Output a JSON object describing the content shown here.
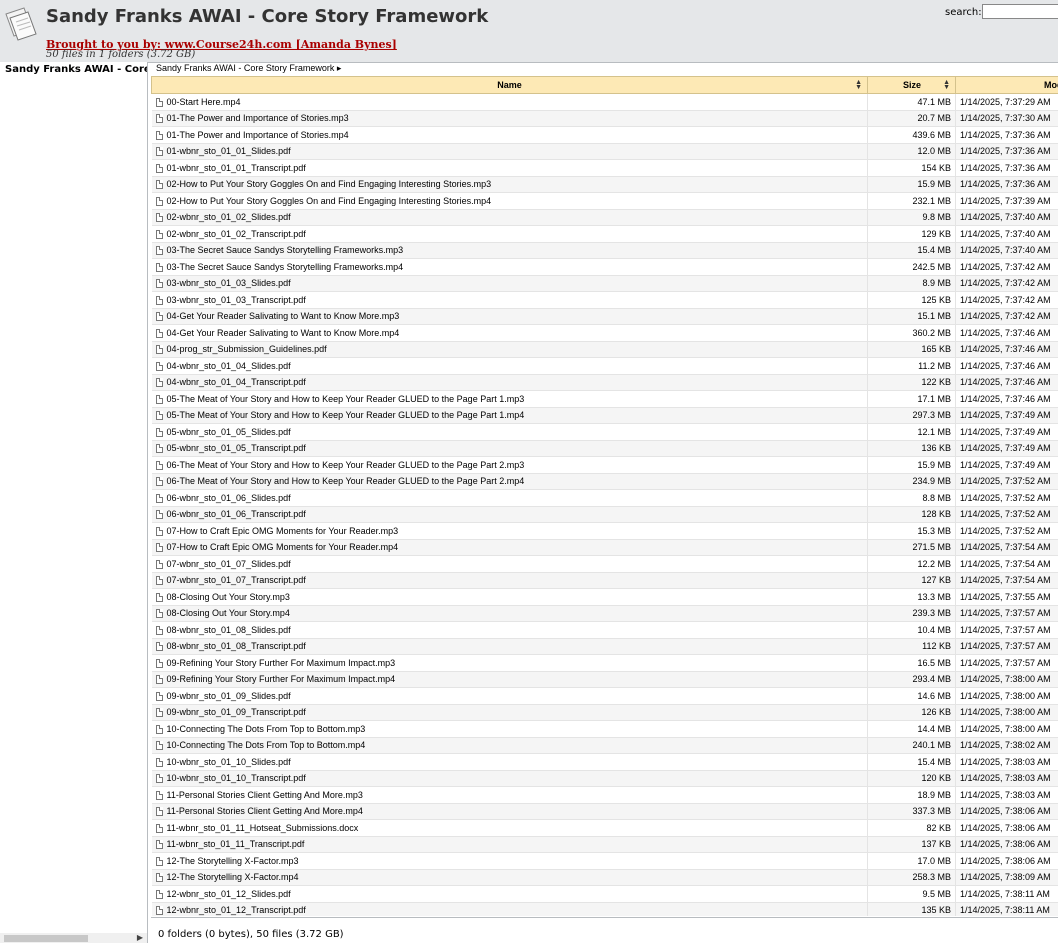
{
  "header": {
    "title": "Sandy Franks AWAI - Core Story Framework",
    "brought_by": "Brought to you by: www.Course24h.com [Amanda Bynes]",
    "summary": "50 files in 1 folders (3.72 GB)",
    "search_label": "search:",
    "search_value": ""
  },
  "tree": {
    "root_label": "Sandy Franks AWAI - Core Story Framework"
  },
  "breadcrumb": {
    "label": "Sandy Franks AWAI - Core Story Framework ▸"
  },
  "table": {
    "columns": {
      "name": "Name",
      "size": "Size",
      "modified": "Modified"
    },
    "rows": [
      {
        "name": "00-Start Here.mp4",
        "size": "47.1 MB",
        "modified": "1/14/2025, 7:37:29 AM"
      },
      {
        "name": "01-The Power and Importance of Stories.mp3",
        "size": "20.7 MB",
        "modified": "1/14/2025, 7:37:30 AM"
      },
      {
        "name": "01-The Power and Importance of Stories.mp4",
        "size": "439.6 MB",
        "modified": "1/14/2025, 7:37:36 AM"
      },
      {
        "name": "01-wbnr_sto_01_01_Slides.pdf",
        "size": "12.0 MB",
        "modified": "1/14/2025, 7:37:36 AM"
      },
      {
        "name": "01-wbnr_sto_01_01_Transcript.pdf",
        "size": "154 KB",
        "modified": "1/14/2025, 7:37:36 AM"
      },
      {
        "name": "02-How to Put Your Story Goggles On and Find Engaging Interesting Stories.mp3",
        "size": "15.9 MB",
        "modified": "1/14/2025, 7:37:36 AM"
      },
      {
        "name": "02-How to Put Your Story Goggles On and Find Engaging Interesting Stories.mp4",
        "size": "232.1 MB",
        "modified": "1/14/2025, 7:37:39 AM"
      },
      {
        "name": "02-wbnr_sto_01_02_Slides.pdf",
        "size": "9.8 MB",
        "modified": "1/14/2025, 7:37:40 AM"
      },
      {
        "name": "02-wbnr_sto_01_02_Transcript.pdf",
        "size": "129 KB",
        "modified": "1/14/2025, 7:37:40 AM"
      },
      {
        "name": "03-The Secret Sauce Sandys Storytelling Frameworks.mp3",
        "size": "15.4 MB",
        "modified": "1/14/2025, 7:37:40 AM"
      },
      {
        "name": "03-The Secret Sauce Sandys Storytelling Frameworks.mp4",
        "size": "242.5 MB",
        "modified": "1/14/2025, 7:37:42 AM"
      },
      {
        "name": "03-wbnr_sto_01_03_Slides.pdf",
        "size": "8.9 MB",
        "modified": "1/14/2025, 7:37:42 AM"
      },
      {
        "name": "03-wbnr_sto_01_03_Transcript.pdf",
        "size": "125 KB",
        "modified": "1/14/2025, 7:37:42 AM"
      },
      {
        "name": "04-Get Your Reader Salivating to Want to Know More.mp3",
        "size": "15.1 MB",
        "modified": "1/14/2025, 7:37:42 AM"
      },
      {
        "name": "04-Get Your Reader Salivating to Want to Know More.mp4",
        "size": "360.2 MB",
        "modified": "1/14/2025, 7:37:46 AM"
      },
      {
        "name": "04-prog_str_Submission_Guidelines.pdf",
        "size": "165 KB",
        "modified": "1/14/2025, 7:37:46 AM"
      },
      {
        "name": "04-wbnr_sto_01_04_Slides.pdf",
        "size": "11.2 MB",
        "modified": "1/14/2025, 7:37:46 AM"
      },
      {
        "name": "04-wbnr_sto_01_04_Transcript.pdf",
        "size": "122 KB",
        "modified": "1/14/2025, 7:37:46 AM"
      },
      {
        "name": "05-The Meat of Your Story and How to Keep Your Reader GLUED to the Page Part 1.mp3",
        "size": "17.1 MB",
        "modified": "1/14/2025, 7:37:46 AM"
      },
      {
        "name": "05-The Meat of Your Story and How to Keep Your Reader GLUED to the Page Part 1.mp4",
        "size": "297.3 MB",
        "modified": "1/14/2025, 7:37:49 AM"
      },
      {
        "name": "05-wbnr_sto_01_05_Slides.pdf",
        "size": "12.1 MB",
        "modified": "1/14/2025, 7:37:49 AM"
      },
      {
        "name": "05-wbnr_sto_01_05_Transcript.pdf",
        "size": "136 KB",
        "modified": "1/14/2025, 7:37:49 AM"
      },
      {
        "name": "06-The Meat of Your Story and How to Keep Your Reader GLUED to the Page Part 2.mp3",
        "size": "15.9 MB",
        "modified": "1/14/2025, 7:37:49 AM"
      },
      {
        "name": "06-The Meat of Your Story and How to Keep Your Reader GLUED to the Page Part 2.mp4",
        "size": "234.9 MB",
        "modified": "1/14/2025, 7:37:52 AM"
      },
      {
        "name": "06-wbnr_sto_01_06_Slides.pdf",
        "size": "8.8 MB",
        "modified": "1/14/2025, 7:37:52 AM"
      },
      {
        "name": "06-wbnr_sto_01_06_Transcript.pdf",
        "size": "128 KB",
        "modified": "1/14/2025, 7:37:52 AM"
      },
      {
        "name": "07-How to Craft Epic OMG Moments for Your Reader.mp3",
        "size": "15.3 MB",
        "modified": "1/14/2025, 7:37:52 AM"
      },
      {
        "name": "07-How to Craft Epic OMG Moments for Your Reader.mp4",
        "size": "271.5 MB",
        "modified": "1/14/2025, 7:37:54 AM"
      },
      {
        "name": "07-wbnr_sto_01_07_Slides.pdf",
        "size": "12.2 MB",
        "modified": "1/14/2025, 7:37:54 AM"
      },
      {
        "name": "07-wbnr_sto_01_07_Transcript.pdf",
        "size": "127 KB",
        "modified": "1/14/2025, 7:37:54 AM"
      },
      {
        "name": "08-Closing Out Your Story.mp3",
        "size": "13.3 MB",
        "modified": "1/14/2025, 7:37:55 AM"
      },
      {
        "name": "08-Closing Out Your Story.mp4",
        "size": "239.3 MB",
        "modified": "1/14/2025, 7:37:57 AM"
      },
      {
        "name": "08-wbnr_sto_01_08_Slides.pdf",
        "size": "10.4 MB",
        "modified": "1/14/2025, 7:37:57 AM"
      },
      {
        "name": "08-wbnr_sto_01_08_Transcript.pdf",
        "size": "112 KB",
        "modified": "1/14/2025, 7:37:57 AM"
      },
      {
        "name": "09-Refining Your Story Further For Maximum Impact.mp3",
        "size": "16.5 MB",
        "modified": "1/14/2025, 7:37:57 AM"
      },
      {
        "name": "09-Refining Your Story Further For Maximum Impact.mp4",
        "size": "293.4 MB",
        "modified": "1/14/2025, 7:38:00 AM"
      },
      {
        "name": "09-wbnr_sto_01_09_Slides.pdf",
        "size": "14.6 MB",
        "modified": "1/14/2025, 7:38:00 AM"
      },
      {
        "name": "09-wbnr_sto_01_09_Transcript.pdf",
        "size": "126 KB",
        "modified": "1/14/2025, 7:38:00 AM"
      },
      {
        "name": "10-Connecting The Dots From Top to Bottom.mp3",
        "size": "14.4 MB",
        "modified": "1/14/2025, 7:38:00 AM"
      },
      {
        "name": "10-Connecting The Dots From Top to Bottom.mp4",
        "size": "240.1 MB",
        "modified": "1/14/2025, 7:38:02 AM"
      },
      {
        "name": "10-wbnr_sto_01_10_Slides.pdf",
        "size": "15.4 MB",
        "modified": "1/14/2025, 7:38:03 AM"
      },
      {
        "name": "10-wbnr_sto_01_10_Transcript.pdf",
        "size": "120 KB",
        "modified": "1/14/2025, 7:38:03 AM"
      },
      {
        "name": "11-Personal Stories Client Getting And More.mp3",
        "size": "18.9 MB",
        "modified": "1/14/2025, 7:38:03 AM"
      },
      {
        "name": "11-Personal Stories Client Getting And More.mp4",
        "size": "337.3 MB",
        "modified": "1/14/2025, 7:38:06 AM"
      },
      {
        "name": "11-wbnr_sto_01_11_Hotseat_Submissions.docx",
        "size": "82 KB",
        "modified": "1/14/2025, 7:38:06 AM"
      },
      {
        "name": "11-wbnr_sto_01_11_Transcript.pdf",
        "size": "137 KB",
        "modified": "1/14/2025, 7:38:06 AM"
      },
      {
        "name": "12-The Storytelling X-Factor.mp3",
        "size": "17.0 MB",
        "modified": "1/14/2025, 7:38:06 AM"
      },
      {
        "name": "12-The Storytelling X-Factor.mp4",
        "size": "258.3 MB",
        "modified": "1/14/2025, 7:38:09 AM"
      },
      {
        "name": "12-wbnr_sto_01_12_Slides.pdf",
        "size": "9.5 MB",
        "modified": "1/14/2025, 7:38:11 AM"
      },
      {
        "name": "12-wbnr_sto_01_12_Transcript.pdf",
        "size": "135 KB",
        "modified": "1/14/2025, 7:38:11 AM"
      }
    ]
  },
  "status": {
    "text": "0 folders (0 bytes), 50 files (3.72 GB)"
  },
  "colors": {
    "header_bg": "#e5e7e9",
    "column_header_bg": "#fde9b5",
    "link_red": "#aa0000"
  }
}
